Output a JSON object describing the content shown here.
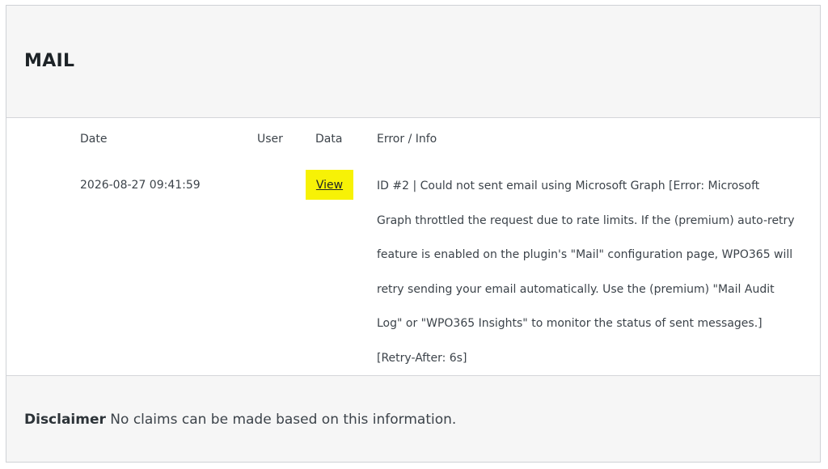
{
  "panel": {
    "title": "MAIL"
  },
  "table": {
    "headers": {
      "date": "Date",
      "user": "User",
      "data": "Data",
      "info": "Error / Info"
    },
    "rows": [
      {
        "date": "2026-08-27 09:41:59",
        "user": "",
        "data_link": "View",
        "info": "ID #2 | Could not sent email using Microsoft Graph [Error: Microsoft Graph throttled the request due to rate limits. If the (premium) auto-retry feature is enabled on the plugin's \"Mail\" configuration page, WPO365 will retry sending your email automatically. Use the (premium) \"Mail Audit Log\" or \"WPO365 Insights\" to monitor the status of sent messages.] [Retry-After: 6s]"
      }
    ]
  },
  "footer": {
    "disclaimer_label": "Disclaimer",
    "disclaimer_text": "No claims can be made based on this information."
  },
  "colors": {
    "highlight": "#f7f206",
    "panel_bg": "#f6f6f6",
    "border": "#cfd2d6"
  }
}
